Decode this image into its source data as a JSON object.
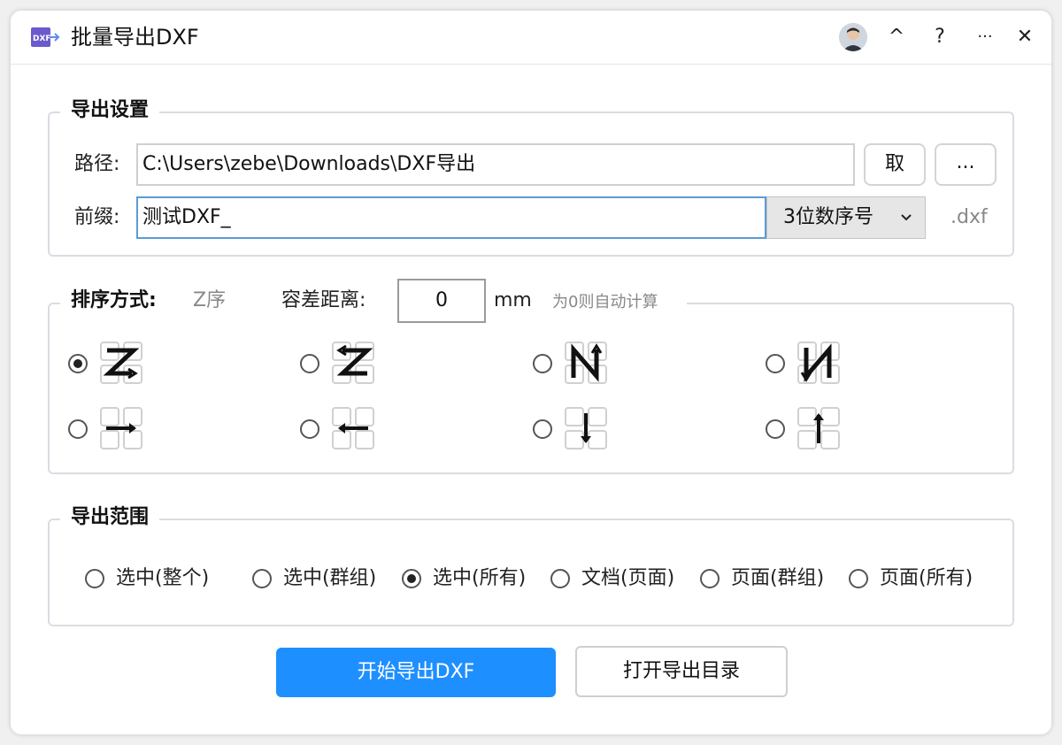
{
  "window": {
    "title": "批量导出DXF"
  },
  "titlebar": {
    "collapse_symbol": "^",
    "help_symbol": "?",
    "more_symbol": "···",
    "close_symbol": "✕"
  },
  "export_settings": {
    "legend": "导出设置",
    "path_label": "路径:",
    "path_value": "C:\\Users\\zebe\\Downloads\\DXF导出",
    "take_button": "取",
    "browse_button": "...",
    "prefix_label": "前缀:",
    "prefix_value": "测试DXF_",
    "numbering_selected": "3位数序号",
    "extension": ".dxf"
  },
  "sorting": {
    "legend": "排序方式:",
    "current_mode": "Z序",
    "tolerance_label": "容差距离:",
    "tolerance_value": "0",
    "tolerance_unit": "mm",
    "tolerance_hint": "为0则自动计算",
    "options": [
      {
        "icon": "z-order-right-icon",
        "checked": true
      },
      {
        "icon": "z-order-left-icon",
        "checked": false
      },
      {
        "icon": "n-order-up-icon",
        "checked": false
      },
      {
        "icon": "n-order-down-icon",
        "checked": false
      },
      {
        "icon": "row-right-icon",
        "checked": false
      },
      {
        "icon": "row-left-icon",
        "checked": false
      },
      {
        "icon": "column-down-icon",
        "checked": false
      },
      {
        "icon": "column-up-icon",
        "checked": false
      }
    ]
  },
  "export_range": {
    "legend": "导出范围",
    "options": [
      {
        "label": "选中(整个)",
        "checked": false
      },
      {
        "label": "选中(群组)",
        "checked": false
      },
      {
        "label": "选中(所有)",
        "checked": true
      },
      {
        "label": "文档(页面)",
        "checked": false
      },
      {
        "label": "页面(群组)",
        "checked": false
      },
      {
        "label": "页面(所有)",
        "checked": false
      }
    ]
  },
  "actions": {
    "start_export": "开始导出DXF",
    "open_folder": "打开导出目录"
  },
  "colors": {
    "primary": "#1e8fff",
    "focus_border": "#5b9bd5",
    "group_border": "#d9dde2",
    "app_icon": "#6a5acd"
  }
}
